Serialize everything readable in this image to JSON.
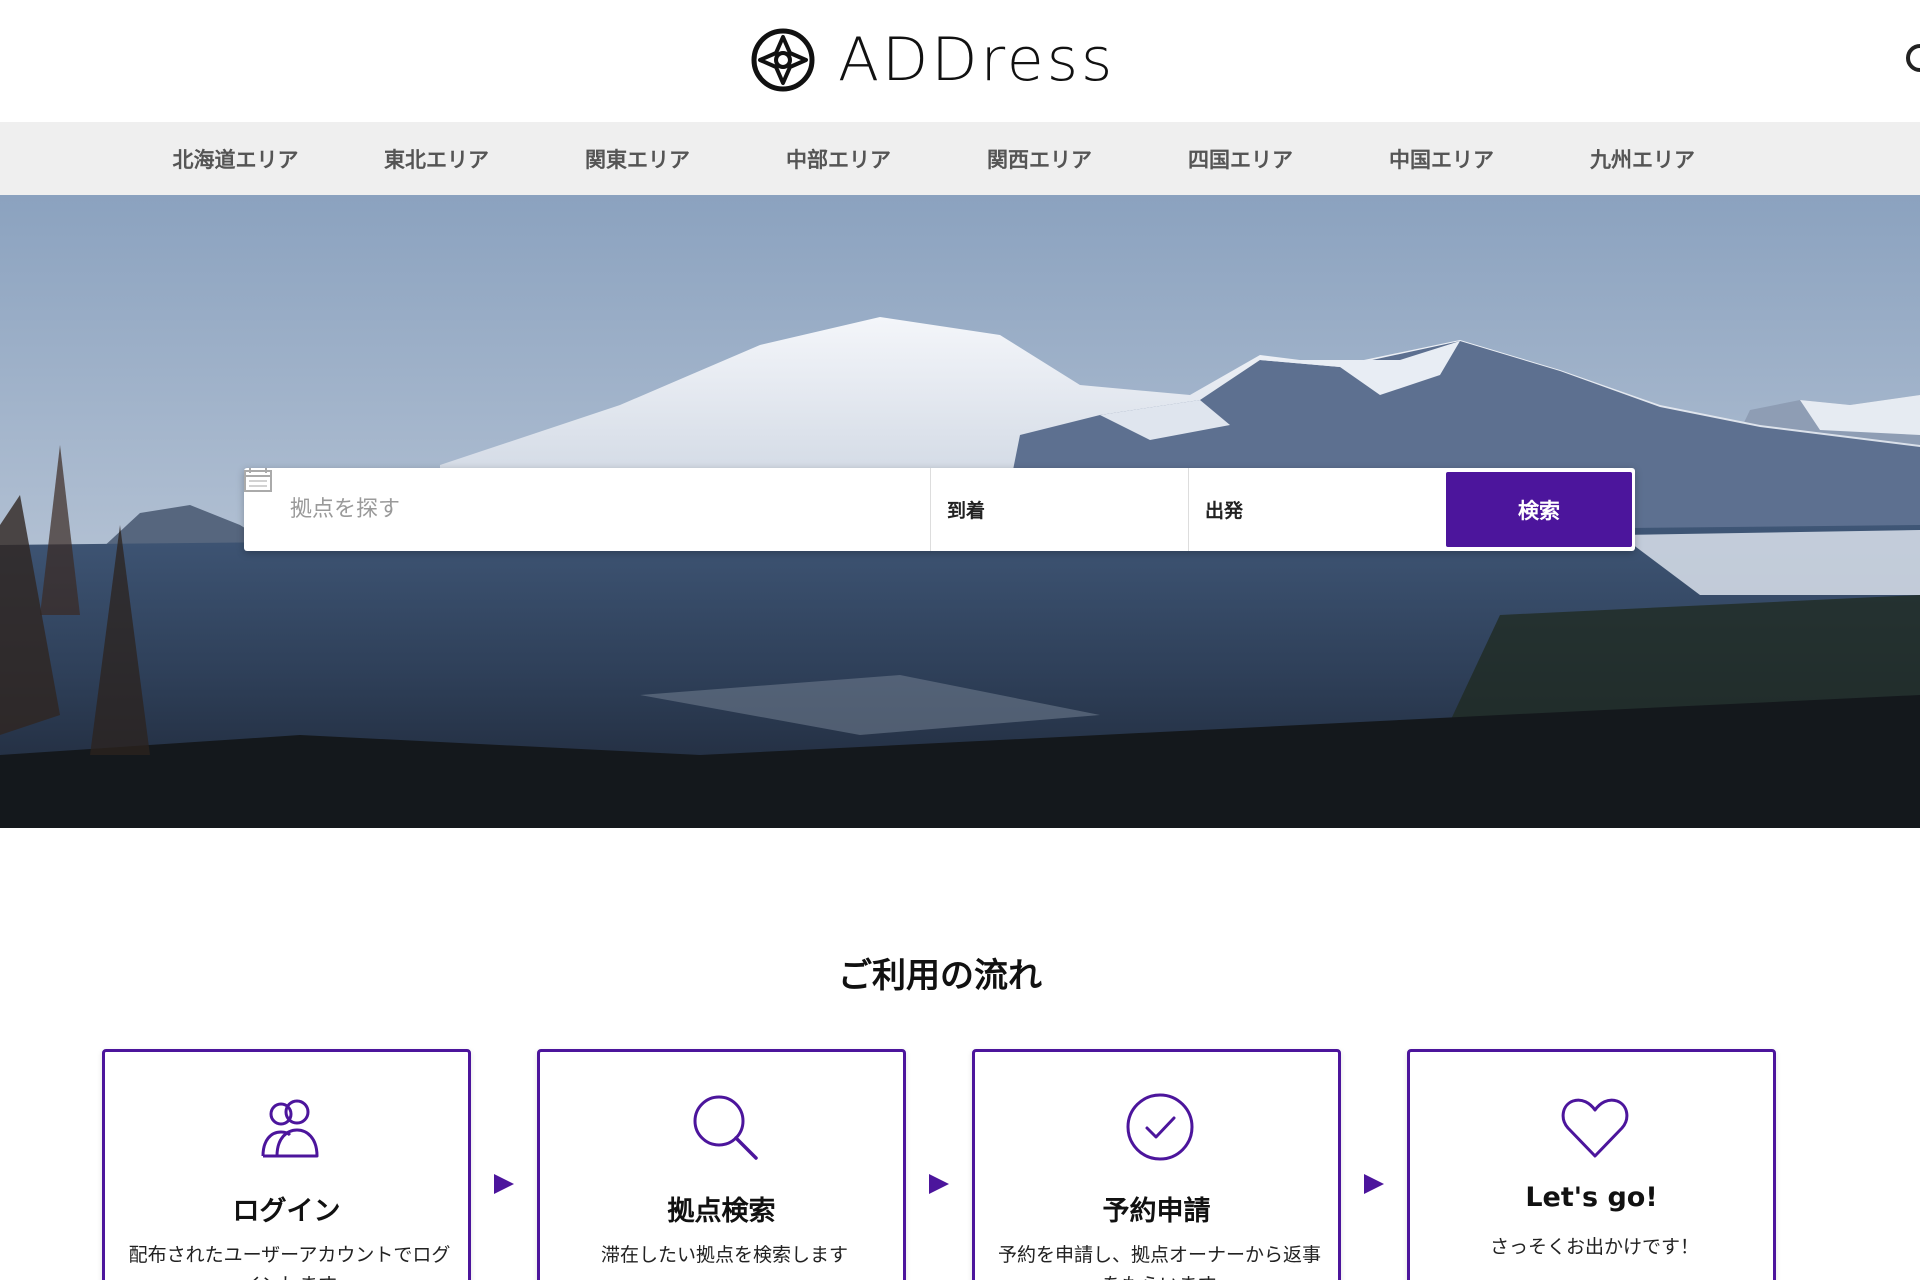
{
  "brand": {
    "name": "ADDress",
    "accent_color": "#4c159c"
  },
  "area_nav": {
    "items": [
      {
        "label": "北海道エリア"
      },
      {
        "label": "東北エリア"
      },
      {
        "label": "関東エリア"
      },
      {
        "label": "中部エリア"
      },
      {
        "label": "関西エリア"
      },
      {
        "label": "四国エリア"
      },
      {
        "label": "中国エリア"
      },
      {
        "label": "九州エリア"
      }
    ]
  },
  "search": {
    "placeholder": "拠点を探す",
    "arrive_label": "到着",
    "depart_label": "出発",
    "button_label": "検索"
  },
  "flow": {
    "title": "ご利用の流れ",
    "steps": [
      {
        "icon": "users-icon",
        "title": "ログイン",
        "desc": "配布されたユーザーアカウントでログインします"
      },
      {
        "icon": "search-icon",
        "title": "拠点検索",
        "desc": "滞在したい拠点を検索します"
      },
      {
        "icon": "check-circle-icon",
        "title": "予約申請",
        "desc": "予約を申請し、拠点オーナーから返事をもらいます"
      },
      {
        "icon": "heart-icon",
        "title": "Let's go!",
        "desc": "さっそくお出かけです！"
      }
    ]
  }
}
